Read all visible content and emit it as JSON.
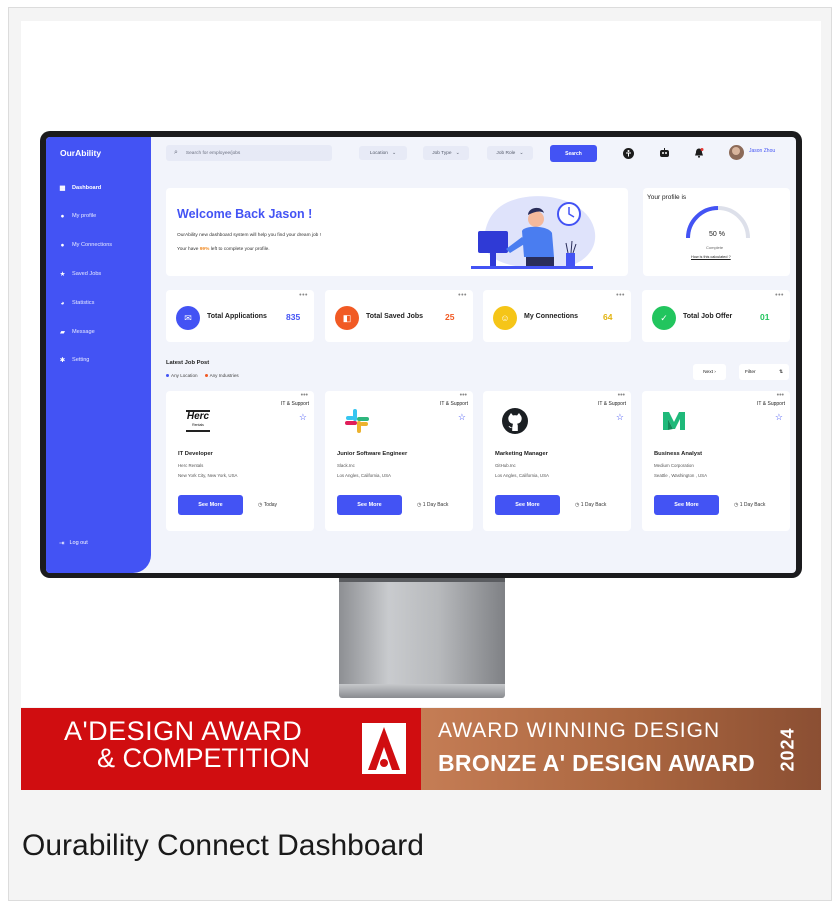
{
  "caption": "Ourability Connect Dashboard",
  "banner": {
    "line1": "A'DESIGN AWARD",
    "line2": "& COMPETITION",
    "award_line1": "AWARD WINNING DESIGN",
    "award_line2": "BRONZE A' DESIGN AWARD",
    "year": "2024"
  },
  "app": {
    "logo": "OurAbility",
    "sidebar": {
      "items": [
        {
          "label": "Dashboard",
          "icon": "grid-icon"
        },
        {
          "label": "My profile",
          "icon": "user-icon"
        },
        {
          "label": "My Connections",
          "icon": "users-icon"
        },
        {
          "label": "Saved Jobs",
          "icon": "star-icon"
        },
        {
          "label": "Statistics",
          "icon": "chart-icon"
        },
        {
          "label": "Message",
          "icon": "chat-icon"
        },
        {
          "label": "Setting",
          "icon": "gear-icon"
        }
      ],
      "logout": "Log out"
    },
    "topbar": {
      "search_placeholder": "Search for employee/jobs",
      "location": "Location",
      "job_type": "Job Type",
      "job_role": "Job Role",
      "search_button": "Search",
      "user_name": "Jason Zhou"
    },
    "welcome": {
      "title": "Welcome Back Jason !",
      "line1": "OurAbility new dashboard system will help you find your dream job !",
      "line2_pre": "Your have ",
      "line2_pct": "99%",
      "line2_post": " left to complete your profile."
    },
    "profile": {
      "label": "Your profile is",
      "value": "50 %",
      "progress": 0.5,
      "complete": "Complete",
      "how": "How is this calculated ?"
    },
    "stats": [
      {
        "label": "Total Applications",
        "value": "835",
        "color": "#4353f4",
        "icon": "applications-icon"
      },
      {
        "label": "Total Saved Jobs",
        "value": "25",
        "color": "#f15a24",
        "icon": "saved-jobs-icon"
      },
      {
        "label": "My Connections",
        "value": "64",
        "color": "#f5c518",
        "icon": "connections-icon"
      },
      {
        "label": "Total Job Offer",
        "value": "01",
        "color": "#22c55e",
        "icon": "job-offer-icon"
      }
    ],
    "latest": {
      "title": "Latest Job Post",
      "filter1": "Any Location",
      "filter2": "Any Industries",
      "next": "Next",
      "filter": "Filter"
    },
    "jobs": [
      {
        "category": "IT & Support",
        "title": "IT Developer",
        "company": "Herc Rentals",
        "location": "New York City, New York, USA",
        "button": "See More",
        "when": "Today",
        "logo_text": "Herc",
        "logo_sub": "Rentals"
      },
      {
        "category": "IT & Support",
        "title": "Junior Software Engineer",
        "company": "Slack.Inc",
        "location": "Los Angles, California, USA",
        "button": "See More",
        "when": "1 Day Back"
      },
      {
        "category": "IT & Support",
        "title": "Marketing Manager",
        "company": "GitHub.Inc",
        "location": "Los Angles, California, USA",
        "button": "See More",
        "when": "1 Day Back"
      },
      {
        "category": "IT & Support",
        "title": "Business Analyst",
        "company": "Medium Corporation",
        "location": "Seattle , Washington , USA",
        "button": "See More",
        "when": "1 Day Back"
      }
    ]
  }
}
